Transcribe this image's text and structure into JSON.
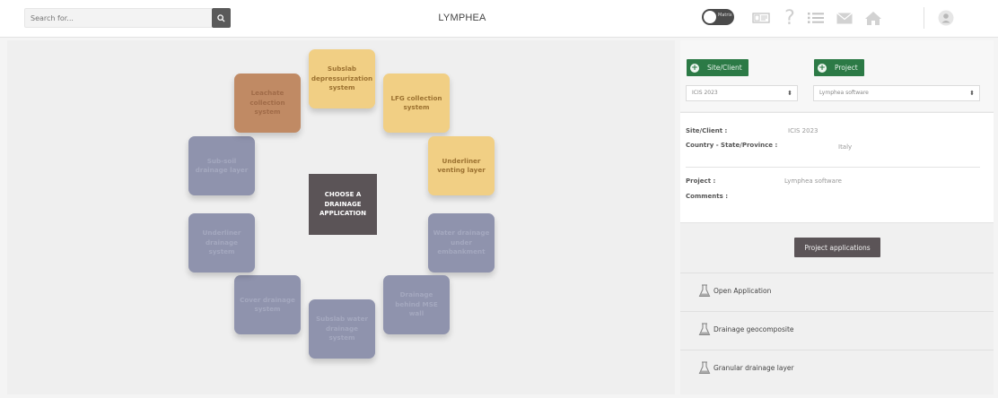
{
  "header": {
    "search_placeholder": "Search for...",
    "title": "LYMPHEA",
    "toggle_label": "Matrix"
  },
  "main": {
    "center_label": "CHOOSE A DRAINAGE APPLICATION",
    "applications": [
      {
        "label": "Subslab depressurization system",
        "color": "yellow"
      },
      {
        "label": "LFG collection system",
        "color": "yellow"
      },
      {
        "label": "Underliner venting layer",
        "color": "yellow"
      },
      {
        "label": "Water drainage under embankment",
        "color": "gray"
      },
      {
        "label": "Drainage behind MSE wall",
        "color": "gray"
      },
      {
        "label": "Subslab water drainage system",
        "color": "gray"
      },
      {
        "label": "Cover drainage system",
        "color": "gray"
      },
      {
        "label": "Underliner drainage system",
        "color": "gray"
      },
      {
        "label": "Sub-soil drainage layer",
        "color": "gray"
      },
      {
        "label": "Leachate collection system",
        "color": "brown"
      }
    ]
  },
  "sidebar": {
    "site_client_button": "Site/Client",
    "project_button": "Project",
    "site_select_value": "ICIS 2023",
    "project_select_value": "Lymphea software",
    "info": {
      "site_client_label": "Site/Client :",
      "site_client_value": "ICIS 2023",
      "country_label": "Country - State/Province :",
      "country_value": "Italy",
      "project_label": "Project :",
      "project_value": "Lymphea software",
      "comments_label": "Comments :"
    },
    "project_applications_button": "Project applications",
    "applications": [
      {
        "label": "Open Application"
      },
      {
        "label": "Drainage geocomposite"
      },
      {
        "label": "Granular drainage layer"
      }
    ]
  },
  "colors": {
    "tile_gray": "#8f93ad",
    "tile_yellow": "#f1cf84",
    "tile_brown": "#c08a64",
    "accent_green": "#2c7a46",
    "dark_button": "#5b5457"
  }
}
